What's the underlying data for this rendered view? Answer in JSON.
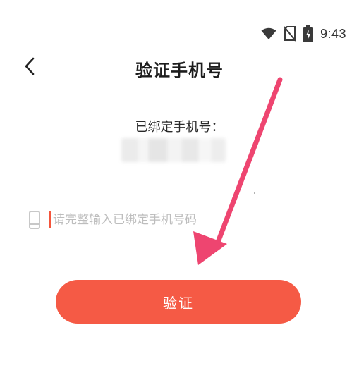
{
  "status_bar": {
    "time": "9:43",
    "icons": [
      "wifi-icon",
      "no-sim-icon",
      "battery-charging-icon"
    ]
  },
  "header": {
    "back_icon": "chevron-left-icon",
    "title": "验证手机号"
  },
  "bound_phone": {
    "label": "已绑定手机号："
  },
  "phone_input": {
    "icon": "mobile-phone-icon",
    "value": "",
    "placeholder": "请完整输入已绑定手机号码"
  },
  "verify_button": {
    "label": "验证"
  },
  "colors": {
    "accent": "#f55a45",
    "arrow": "#ee4570",
    "cursor": "#f4553c"
  }
}
